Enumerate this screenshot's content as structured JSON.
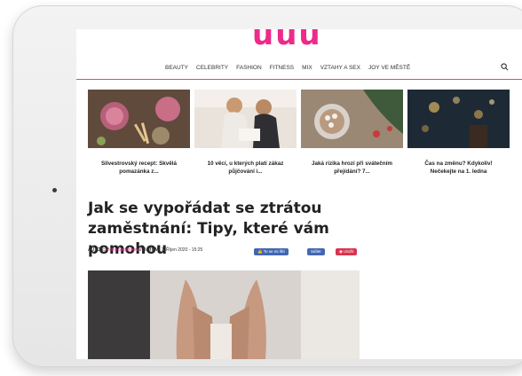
{
  "site": {
    "logo": "uuu"
  },
  "nav": {
    "items": [
      "BEAUTY",
      "CELEBRITY",
      "FASHION",
      "FITNESS",
      "MIX",
      "VZTAHY A SEX",
      "JOY VE MĚSTĚ"
    ],
    "search_icon": "search-icon"
  },
  "related": [
    {
      "caption": "Silvestrovský recept: Skvělá pomazánka z..."
    },
    {
      "caption": "10 věcí, u kterých platí zákaz půjčování i..."
    },
    {
      "caption": "Jaká rizika hrozí při svátečním přejídání? 7..."
    },
    {
      "caption": "Čas na změnu? Kdykoliv! Nečekejte na 1. ledna"
    }
  ],
  "article": {
    "title": "Jak se vypořádat se ztrátou zaměstnání: Tipy, které vám pomohou",
    "author_label": "AUTOR:",
    "author": "Petra Šebánková",
    "date_label": "/ DATUM:",
    "date": "7. Říjen 2020 - 15:25"
  },
  "share": {
    "like": "To se mi líbí",
    "share": "Sdílet",
    "save": "Uložit"
  },
  "colors": {
    "accent": "#e5409a",
    "facebook": "#4267b2",
    "pinterest": "#d9334f"
  }
}
